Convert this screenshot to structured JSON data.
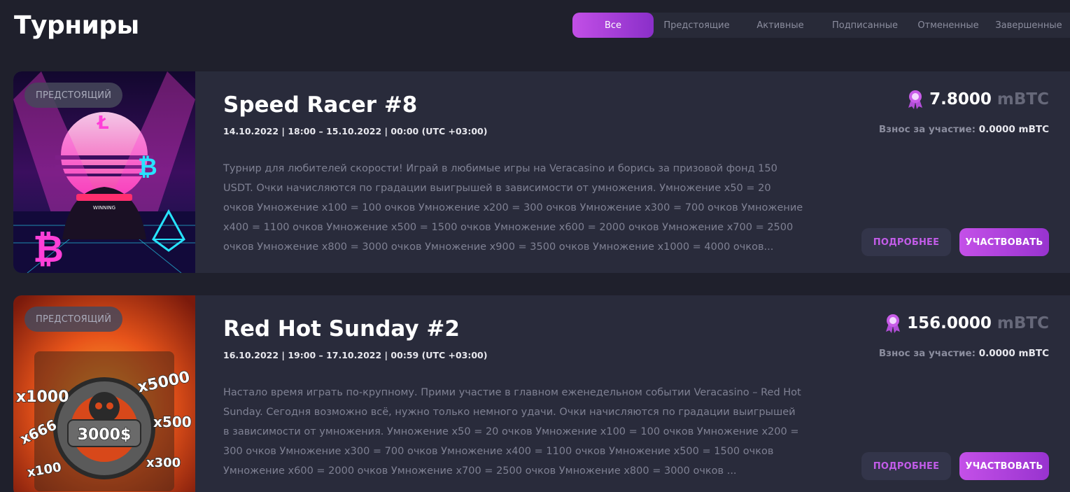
{
  "page": {
    "title": "Турниры"
  },
  "filters": [
    {
      "label": "Все",
      "active": true
    },
    {
      "label": "Предстоящие",
      "active": false
    },
    {
      "label": "Активные",
      "active": false
    },
    {
      "label": "Подписанные",
      "active": false
    },
    {
      "label": "Отмененные",
      "active": false
    },
    {
      "label": "Завершенные",
      "active": false
    }
  ],
  "tournaments": [
    {
      "status": "ПРЕДСТОЯЩИЙ",
      "title": "Speed Racer #8",
      "dates": "14.10.2022 | 18:00 – 15.10.2022 | 00:00 (UTC +03:00)",
      "description": "Турнир для любителей скорости! Играй в любимые игры на Veracasino и борись за призовой фонд 150 USDT. Очки начисляются по градации выигрышей в зависимости от умножения. Умножение x50 = 20 очков Умножение x100 = 100 очков Умножение x200 = 300 очков Умножение x300 = 700 очков Умножение x400 = 1100 очков Умножение x500 = 1500 очков Умножение x600 = 2000 очков Умножение x700 = 2500 очков Умножение x800 = 3000 очков Умножение x900 = 3500 очков Умножение x1000 = 4000 очков...",
      "prize_amount": "7.8000",
      "prize_unit": "mBTC",
      "fee_label": "Взнос за участие:",
      "fee_value": "0.0000 mBTC",
      "details_label": "ПОДРОБНЕЕ",
      "join_label": "УЧАСТВОВАТЬ",
      "thumb_text": "WINNING"
    },
    {
      "status": "ПРЕДСТОЯЩИЙ",
      "title": "Red Hot Sunday #2",
      "dates": "16.10.2022 | 19:00 – 17.10.2022 | 00:59 (UTC +03:00)",
      "description": "Настало время играть по-крупному. Прими участие в главном еженедельном событии Veracasino – Red Hot Sunday. Сегодня возможно всё, нужно только немного удачи.  Очки начисляются по градации выигрышей в зависимости от умножения. Умножение x50 = 20 очков Умножение x100 = 100 очков Умножение x200 = 300 очков Умножение x300 = 700 очков Умножение x400 = 1100 очков Умножение x500 = 1500 очков Умножение x600 = 2000 очков Умножение x700 = 2500 очков Умножение x800 = 3000 очков ...",
      "prize_amount": "156.0000",
      "prize_unit": "mBTC",
      "fee_label": "Взнос за участие:",
      "fee_value": "0.0000 mBTC",
      "details_label": "ПОДРОБНЕЕ",
      "join_label": "УЧАСТВОВАТЬ",
      "thumb_labels": [
        "x1000",
        "x5000",
        "x666",
        "x500",
        "3000$",
        "x100",
        "x300"
      ]
    }
  ],
  "colors": {
    "background": "#1f202c",
    "card": "#292b3b",
    "accent": "#c24fe6",
    "muted_text": "#7f8193"
  },
  "icons": {
    "prize": "award-ribbon-icon"
  }
}
